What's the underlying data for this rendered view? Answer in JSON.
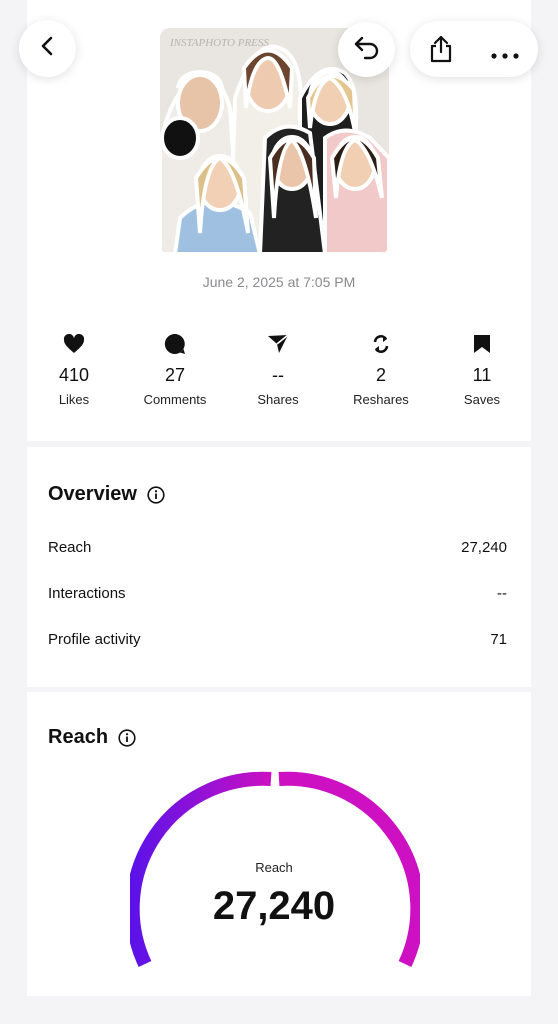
{
  "post": {
    "date": "June 2, 2025 at 7:05 PM",
    "image_watermark": "INSTAPHOTO PRESS"
  },
  "stats": [
    {
      "icon": "heart-icon",
      "value": "410",
      "label": "Likes"
    },
    {
      "icon": "comment-icon",
      "value": "27",
      "label": "Comments"
    },
    {
      "icon": "send-icon",
      "value": "--",
      "label": "Shares"
    },
    {
      "icon": "repost-icon",
      "value": "2",
      "label": "Reshares"
    },
    {
      "icon": "bookmark-icon",
      "value": "11",
      "label": "Saves"
    }
  ],
  "overview": {
    "title": "Overview",
    "rows": [
      {
        "label": "Reach",
        "value": "27,240"
      },
      {
        "label": "Interactions",
        "value": "--"
      },
      {
        "label": "Profile activity",
        "value": "71"
      }
    ]
  },
  "reach": {
    "title": "Reach",
    "gauge_label": "Reach",
    "gauge_value": "27,240",
    "gradient_start": "#5b12e8",
    "gradient_end": "#cc10c2"
  }
}
